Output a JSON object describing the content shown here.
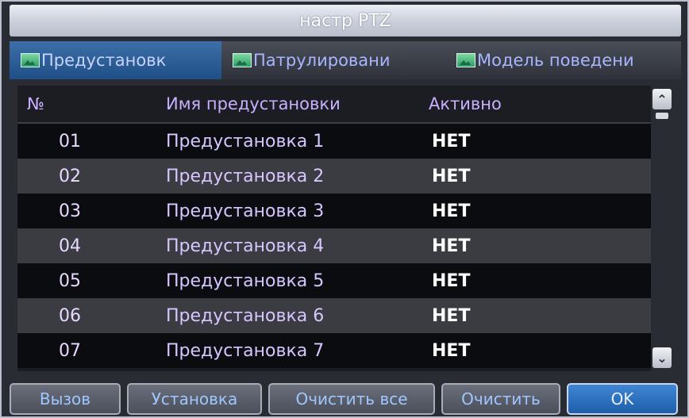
{
  "title": "настр PTZ",
  "tabs": [
    {
      "label": "Предустановк"
    },
    {
      "label": "Патрулировани"
    },
    {
      "label": "Модель поведени"
    }
  ],
  "table": {
    "headers": {
      "num": "№",
      "name": "Имя предустановки",
      "active": "Активно"
    },
    "rows": [
      {
        "num": "01",
        "name": "Предустановка 1",
        "active": "НЕТ"
      },
      {
        "num": "02",
        "name": "Предустановка 2",
        "active": "НЕТ"
      },
      {
        "num": "03",
        "name": "Предустановка 3",
        "active": "НЕТ"
      },
      {
        "num": "04",
        "name": "Предустановка 4",
        "active": "НЕТ"
      },
      {
        "num": "05",
        "name": "Предустановка 5",
        "active": "НЕТ"
      },
      {
        "num": "06",
        "name": "Предустановка 6",
        "active": "НЕТ"
      },
      {
        "num": "07",
        "name": "Предустановка 7",
        "active": "НЕТ"
      }
    ]
  },
  "buttons": {
    "call": "Вызов",
    "set": "Установка",
    "clear_all": "Очистить все",
    "clear": "Очистить",
    "ok": "OK"
  },
  "icons": {
    "tab": "picture-icon",
    "scroll_up": "chevron-up-icon",
    "scroll_down": "chevron-down-icon"
  },
  "colors": {
    "active_tab": "#2a5e98",
    "ok_button": "#2f74c4",
    "header_text": "#c8b0ff"
  }
}
